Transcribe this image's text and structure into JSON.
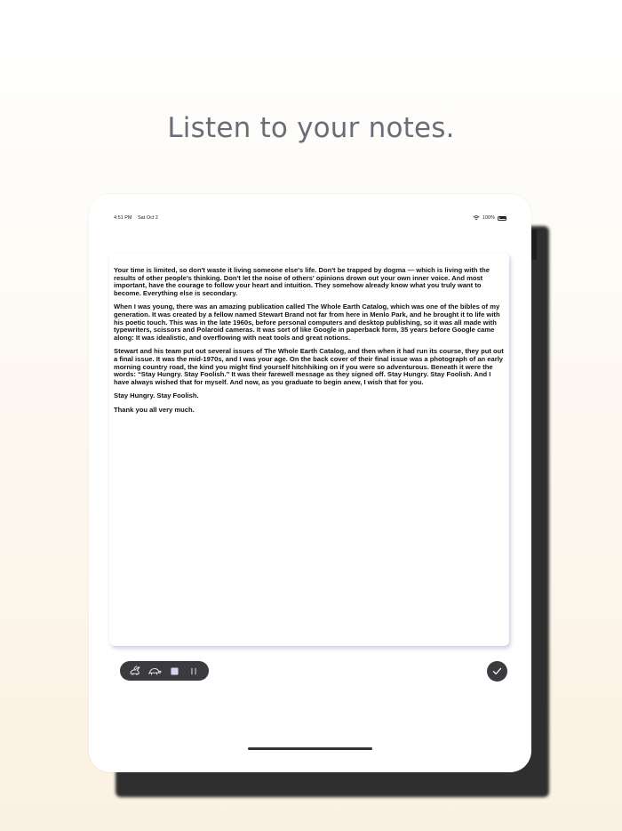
{
  "headline": "Listen to your notes.",
  "status": {
    "time": "4:51 PM",
    "date": "Sat Oct 2",
    "battery": "100%"
  },
  "note": {
    "paragraphs": [
      "Your time is limited, so don't waste it living someone else's life. Don't be trapped by dogma — which is living with the results of other people's thinking. Don't let the noise of others' opinions drown out your own inner voice. And most important, have the courage to follow your heart and intuition. They somehow already know what you truly want to become. Everything else is secondary.",
      "When I was young, there was an amazing publication called The Whole Earth Catalog, which was one of the bibles of my generation. It was created by a fellow named Stewart Brand not far from here in Menlo Park, and he brought it to life with his poetic touch. This was in the late 1960s, before personal computers and desktop publishing, so it was all made with typewriters, scissors and Polaroid cameras. It was sort of like Google in paperback form, 35 years before Google came along: It was idealistic, and overflowing with neat tools and great notions.",
      "Stewart and his team put out several issues of The Whole Earth Catalog, and then when it had run its course, they put out a final issue. It was the mid-1970s, and I was your age. On the back cover of their final issue was a photograph of an early morning country road, the kind you might find yourself hitchhiking on if you were so adventurous. Beneath it were the words: “Stay Hungry. Stay Foolish.” It was their farewell message as they signed off. Stay Hungry. Stay Foolish. And I have always wished that for myself. And now, as you graduate to begin anew, I wish that for you.",
      "Stay Hungry. Stay Foolish.",
      "Thank you all very much."
    ]
  },
  "toolbar": {
    "icons": [
      "rabbit-icon",
      "turtle-icon",
      "stop-icon",
      "pause-icon"
    ],
    "done_icon": "checkmark-icon"
  },
  "colors": {
    "headline": "#6a6c78",
    "toolbar_bg": "#3b3b3f",
    "stop_accent": "#d8d4f4"
  }
}
